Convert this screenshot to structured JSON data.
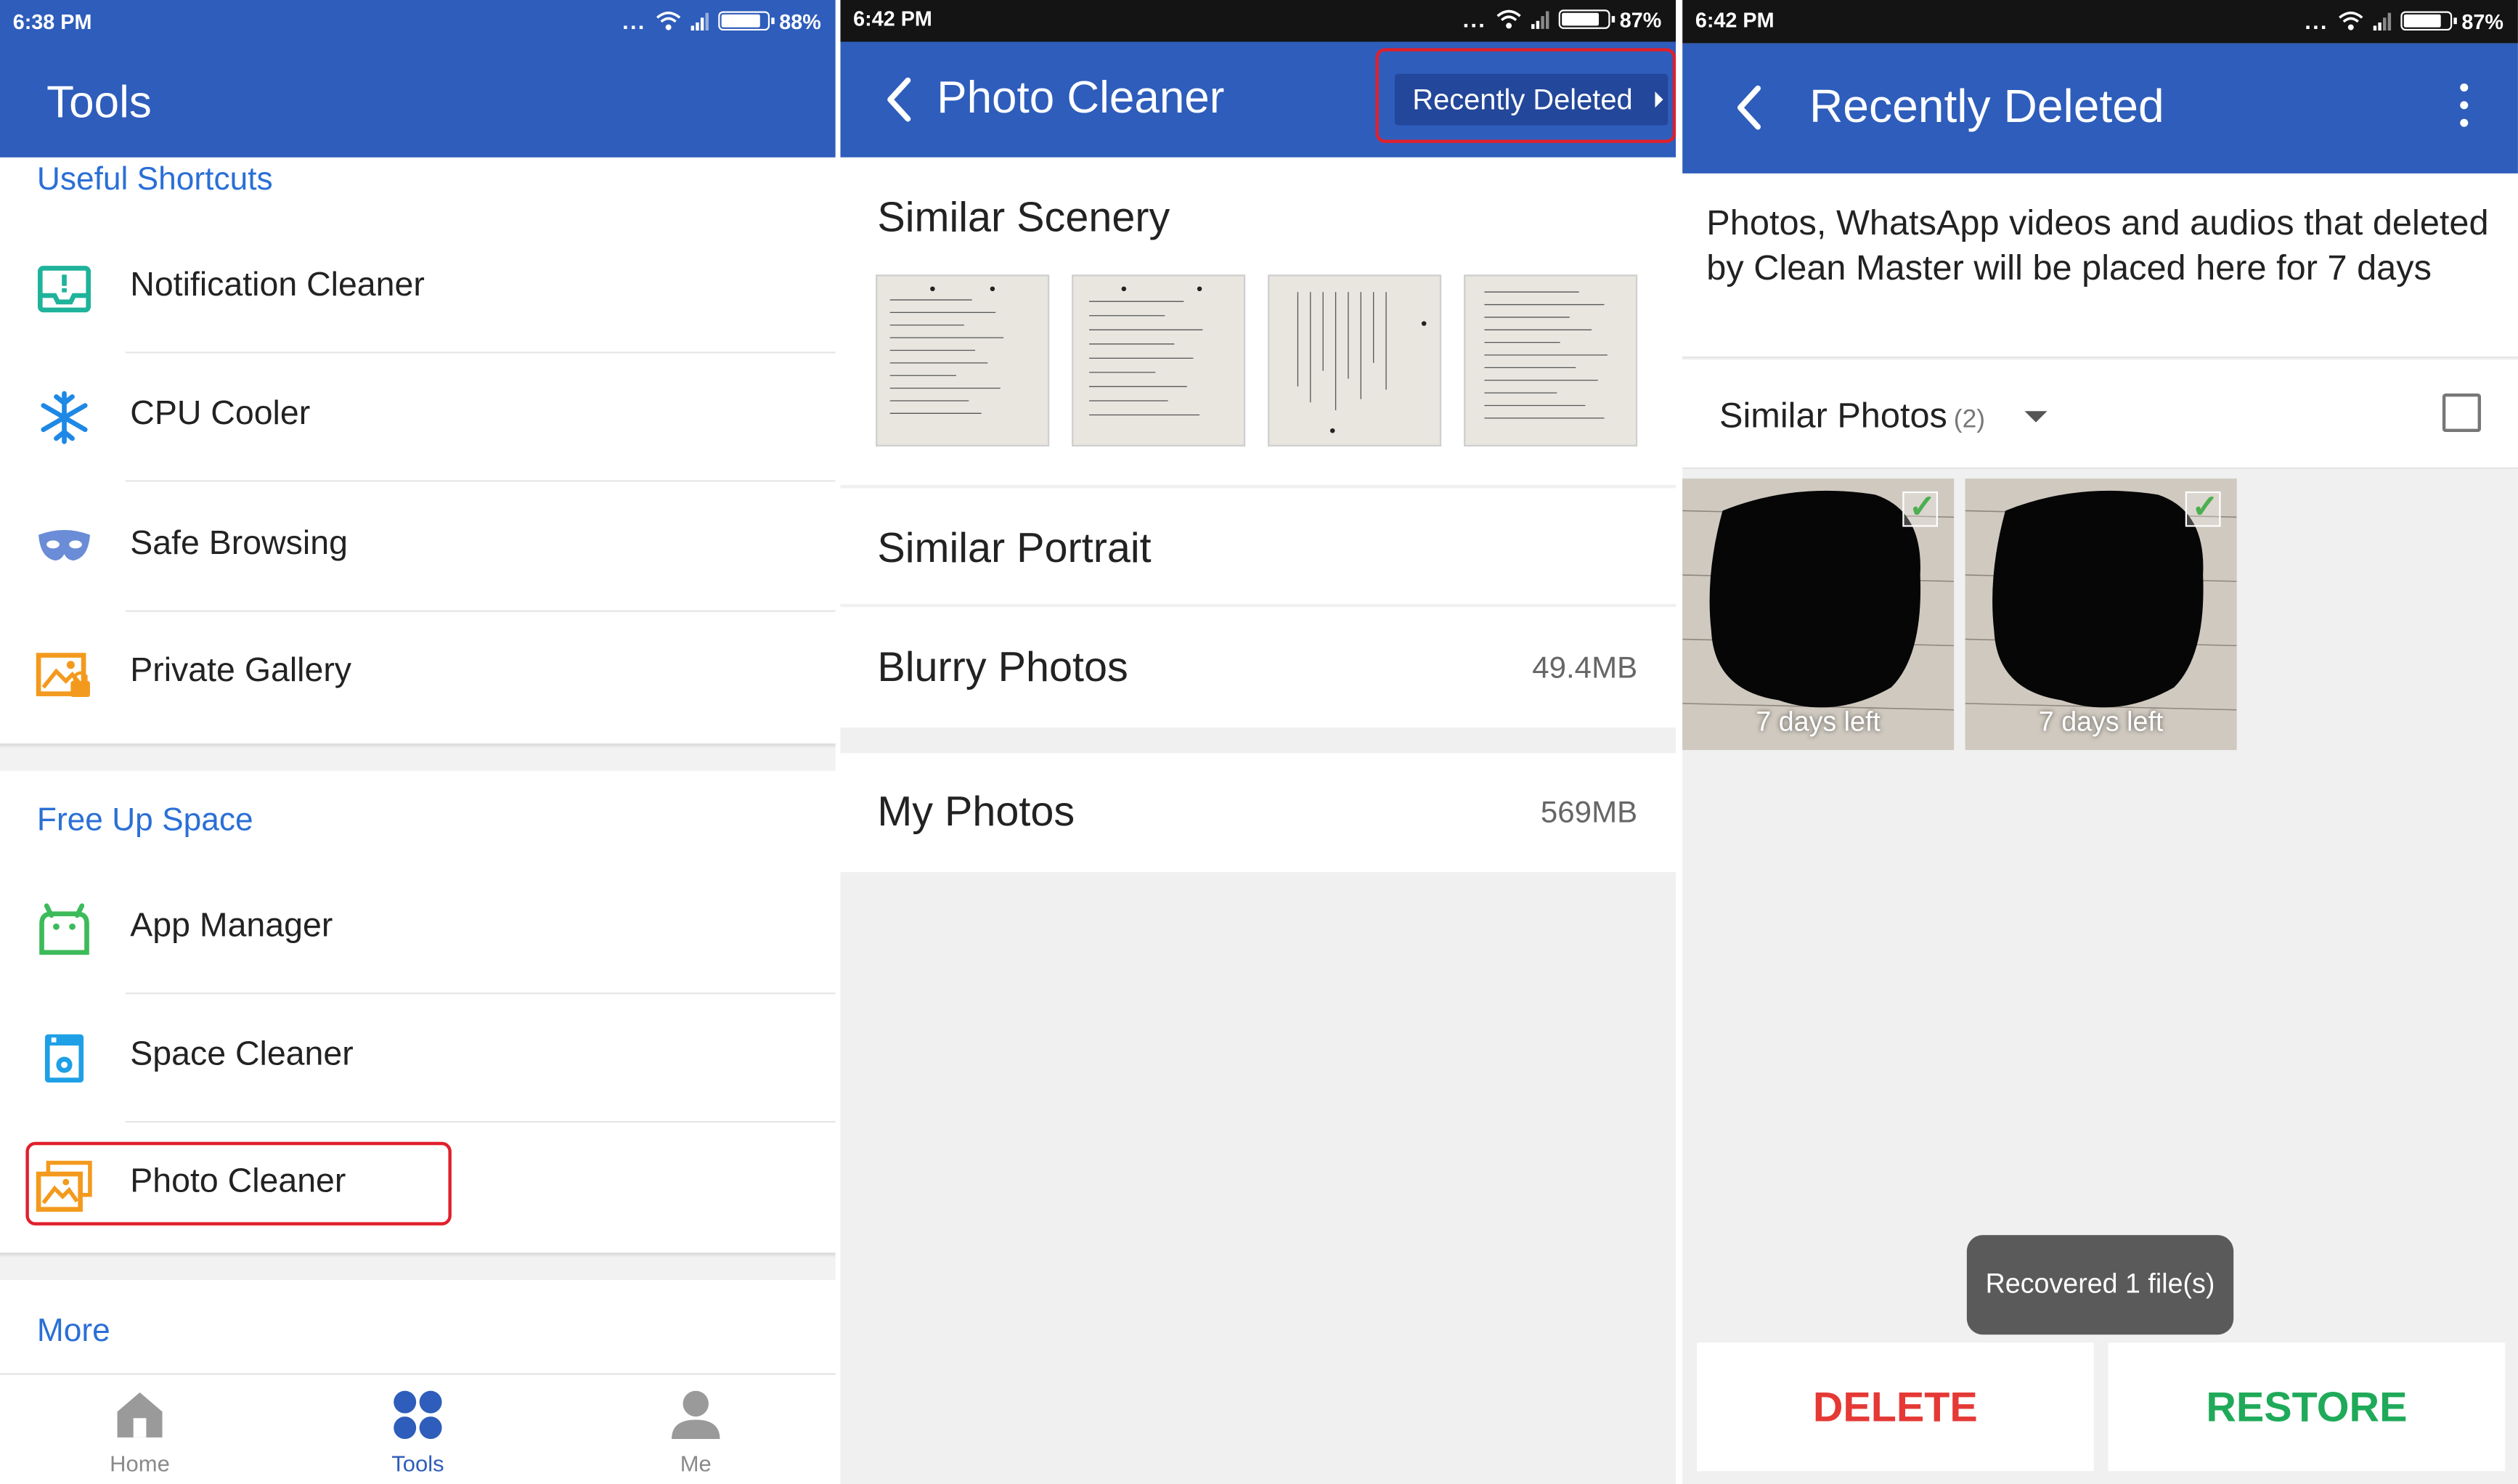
{
  "panel1": {
    "status": {
      "time": "6:38 PM",
      "dots": "...",
      "battery": "88%",
      "battery_level": 0.88
    },
    "title": "Tools",
    "sections": {
      "useful": {
        "title": "Useful Shortcuts",
        "items": [
          {
            "label": "Notification Cleaner",
            "icon": "notification-tray-icon"
          },
          {
            "label": "CPU Cooler",
            "icon": "snowflake-icon"
          },
          {
            "label": "Safe Browsing",
            "icon": "mask-icon"
          },
          {
            "label": "Private Gallery",
            "icon": "locked-gallery-icon"
          }
        ]
      },
      "free": {
        "title": "Free Up Space",
        "items": [
          {
            "label": "App Manager",
            "icon": "android-icon"
          },
          {
            "label": "Space Cleaner",
            "icon": "storage-icon"
          },
          {
            "label": "Photo Cleaner",
            "icon": "photos-icon"
          }
        ]
      },
      "more": {
        "title": "More"
      }
    },
    "nav": [
      {
        "label": "Home",
        "icon": "home-icon"
      },
      {
        "label": "Tools",
        "icon": "tools-grid-icon"
      },
      {
        "label": "Me",
        "icon": "person-icon"
      }
    ],
    "colors": {
      "appbar": "#2e5dbb",
      "section_title": "#2a6fd6",
      "highlight": "#e0202c"
    }
  },
  "panel2": {
    "status": {
      "time": "6:42 PM",
      "dots": "...",
      "battery": "87%",
      "battery_level": 0.87
    },
    "title": "Photo Cleaner",
    "recently_deleted_button": "Recently Deleted",
    "sections": {
      "scenery": {
        "label": "Similar Scenery"
      },
      "portrait": {
        "label": "Similar Portrait"
      },
      "blurry": {
        "label": "Blurry Photos",
        "size": "49.4MB"
      },
      "myphotos": {
        "label": "My Photos",
        "size": "569MB"
      }
    }
  },
  "panel3": {
    "status": {
      "time": "6:42 PM",
      "dots": "...",
      "battery": "87%",
      "battery_level": 0.87
    },
    "title": "Recently Deleted",
    "info": "Photos, WhatsApp videos and audios that deleted by Clean Master will be placed here for 7 days",
    "group": {
      "label": "Similar Photos",
      "count": "(2)"
    },
    "photos": [
      {
        "label": "7 days left",
        "checked": true
      },
      {
        "label": "7 days left",
        "checked": true
      }
    ],
    "toast": "Recovered 1 file(s)",
    "delete_label": "DELETE",
    "restore_label": "RESTORE",
    "colors": {
      "delete": "#e53935",
      "restore": "#1faa59"
    }
  }
}
